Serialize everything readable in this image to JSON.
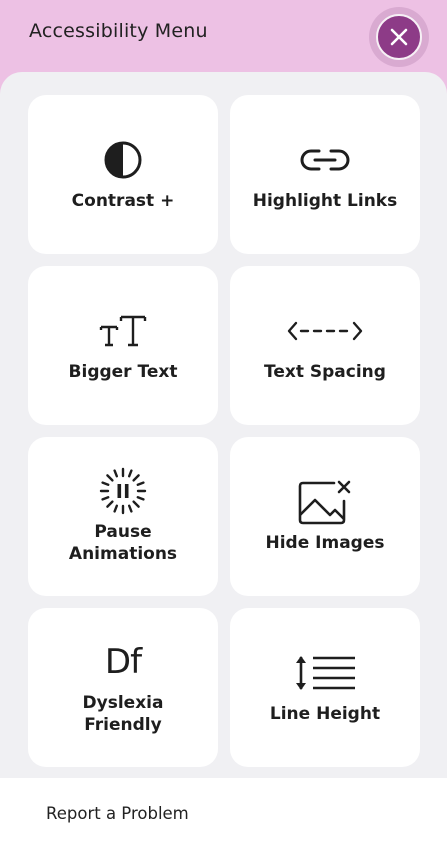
{
  "header": {
    "title": "Accessibility Menu",
    "close_icon": "close-icon"
  },
  "colors": {
    "header_bg": "#edc1e4",
    "close_button": "#8d3b87",
    "panel_bg": "#f0f0f3",
    "tile_bg": "#ffffff"
  },
  "tiles": [
    {
      "label": "Contrast +",
      "icon": "contrast-icon"
    },
    {
      "label": "Highlight Links",
      "icon": "link-icon"
    },
    {
      "label": "Bigger Text",
      "icon": "text-size-icon"
    },
    {
      "label": "Text Spacing",
      "icon": "text-spacing-icon"
    },
    {
      "label": "Pause\nAnimations",
      "icon": "pause-animation-icon"
    },
    {
      "label": "Hide Images",
      "icon": "hide-image-icon"
    },
    {
      "label": "Dyslexia\nFriendly",
      "icon": "dyslexia-icon",
      "glyph": "Df"
    },
    {
      "label": "Line Height",
      "icon": "line-height-icon"
    }
  ],
  "footer": {
    "report_label": "Report a Problem"
  }
}
